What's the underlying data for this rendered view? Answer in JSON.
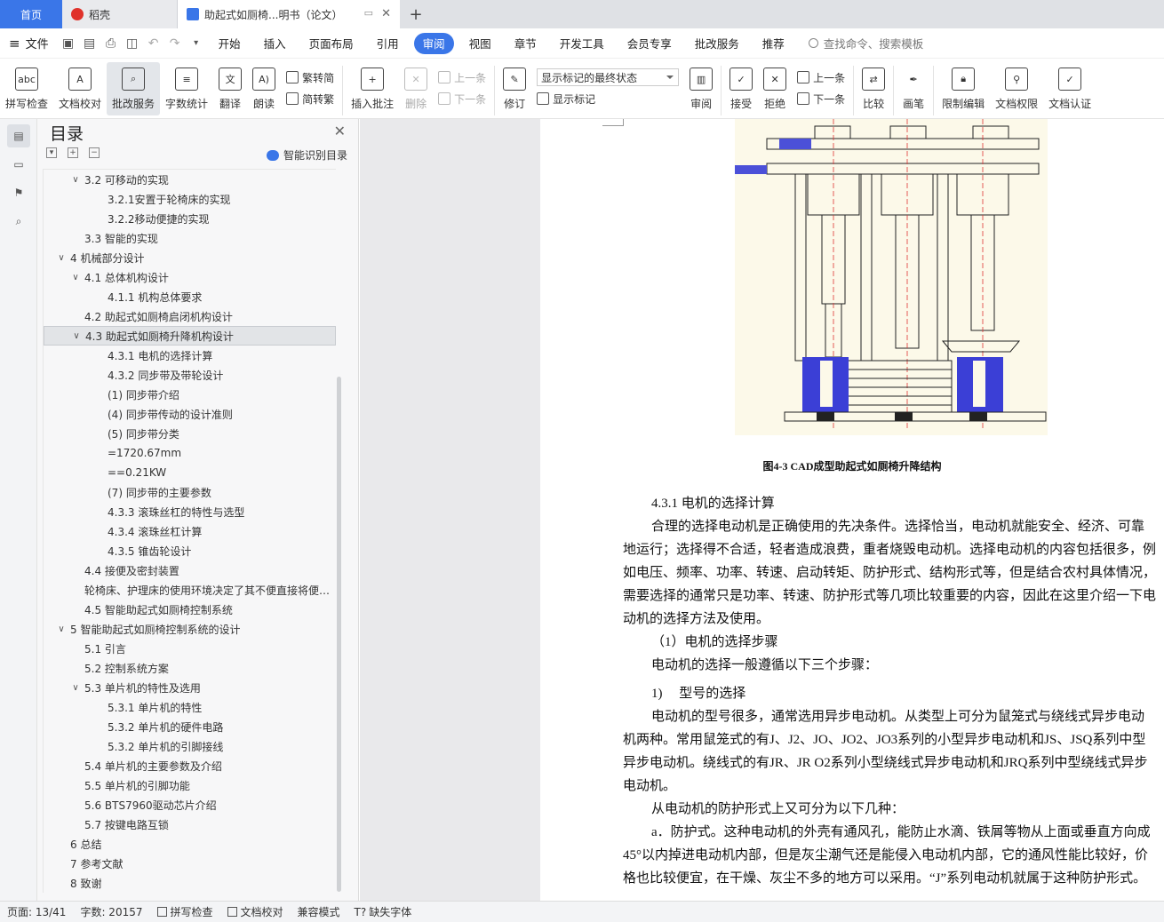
{
  "tabs": {
    "home": "首页",
    "docer": "稻壳",
    "doc": "助起式如厕椅...明书（论文）"
  },
  "menu": {
    "file": "文件",
    "items": [
      "开始",
      "插入",
      "页面布局",
      "引用",
      "审阅",
      "视图",
      "章节",
      "开发工具",
      "会员专享",
      "批改服务",
      "推荐"
    ],
    "active": "审阅",
    "search": "查找命令、搜索模板"
  },
  "ribbon": {
    "spell": "拼写检查",
    "proof": "文档校对",
    "review_service": "批改服务",
    "word_count": "字数统计",
    "translate": "翻译",
    "read": "朗读",
    "trad": "繁转简",
    "simp": "简转繁",
    "insert_comment": "插入批注",
    "delete": "删除",
    "prev": "上一条",
    "next": "下一条",
    "track": "修订",
    "markup_state": "显示标记的最终状态",
    "show_markup": "显示标记",
    "review": "审阅",
    "accept": "接受",
    "reject": "拒绝",
    "prev2": "上一条",
    "next2": "下一条",
    "compare": "比较",
    "pen": "画笔",
    "restrict": "限制编辑",
    "rights": "文档权限",
    "auth": "文档认证"
  },
  "toc": {
    "title": "目录",
    "smart": "智能识别目录",
    "items": [
      {
        "level": 2,
        "text": "3.2 可移动的实现",
        "chev": "∨"
      },
      {
        "level": 3,
        "text": "3.2.1安置于轮椅床的实现",
        "chev": ""
      },
      {
        "level": 3,
        "text": "3.2.2移动便捷的实现",
        "chev": ""
      },
      {
        "level": 2,
        "text": "3.3 智能的实现",
        "chev": ""
      },
      {
        "level": 1,
        "text": "4 机械部分设计",
        "chev": "∨"
      },
      {
        "level": 2,
        "text": "4.1 总体机构设计",
        "chev": "∨"
      },
      {
        "level": 3,
        "text": "4.1.1 机构总体要求",
        "chev": ""
      },
      {
        "level": 2,
        "text": "4.2 助起式如厕椅启闭机构设计",
        "chev": ""
      },
      {
        "level": 2,
        "text": "4.3 助起式如厕椅升降机构设计",
        "chev": "∨",
        "selected": true
      },
      {
        "level": 3,
        "text": "4.3.1 电机的选择计算",
        "chev": ""
      },
      {
        "level": 3,
        "text": "4.3.2 同步带及带轮设计",
        "chev": ""
      },
      {
        "level": 3,
        "text": "(1) 同步带介绍",
        "chev": ""
      },
      {
        "level": 3,
        "text": "(4) 同步带传动的设计准则",
        "chev": ""
      },
      {
        "level": 3,
        "text": "(5) 同步带分类",
        "chev": ""
      },
      {
        "level": 3,
        "text": "=1720.67mm",
        "chev": ""
      },
      {
        "level": 3,
        "text": "==0.21KW",
        "chev": ""
      },
      {
        "level": 3,
        "text": "(7) 同步带的主要参数",
        "chev": ""
      },
      {
        "level": 3,
        "text": "4.3.3 滚珠丝杠的特性与选型",
        "chev": ""
      },
      {
        "level": 3,
        "text": "4.3.4 滚珠丝杠计算",
        "chev": ""
      },
      {
        "level": 3,
        "text": "4.3.5 锥齿轮设计",
        "chev": ""
      },
      {
        "level": 2,
        "text": "4.4 接便及密封装置",
        "chev": ""
      },
      {
        "level": 2,
        "text": "轮椅床、护理床的使用环境决定了其不便直接将便…",
        "chev": ""
      },
      {
        "level": 2,
        "text": "4.5 智能助起式如厕椅控制系统",
        "chev": ""
      },
      {
        "level": 1,
        "text": "5 智能助起式如厕椅控制系统的设计",
        "chev": "∨"
      },
      {
        "level": 2,
        "text": "5.1 引言",
        "chev": ""
      },
      {
        "level": 2,
        "text": "5.2 控制系统方案",
        "chev": ""
      },
      {
        "level": 2,
        "text": "5.3 单片机的特性及选用",
        "chev": "∨"
      },
      {
        "level": 3,
        "text": "5.3.1 单片机的特性",
        "chev": ""
      },
      {
        "level": 3,
        "text": "5.3.2 单片机的硬件电路",
        "chev": ""
      },
      {
        "level": 3,
        "text": "5.3.2 单片机的引脚接线",
        "chev": ""
      },
      {
        "level": 2,
        "text": "5.4 单片机的主要参数及介绍",
        "chev": ""
      },
      {
        "level": 2,
        "text": "5.5 单片机的引脚功能",
        "chev": ""
      },
      {
        "level": 2,
        "text": "5.6 BTS7960驱动芯片介绍",
        "chev": ""
      },
      {
        "level": 2,
        "text": "5.7 按键电路互锁",
        "chev": ""
      },
      {
        "level": 1,
        "text": "6 总结",
        "chev": ""
      },
      {
        "level": 1,
        "text": "7 参考文献",
        "chev": ""
      },
      {
        "level": 1,
        "text": "8 致谢",
        "chev": ""
      }
    ]
  },
  "doc": {
    "caption": "图4-3 CAD成型助起式如厕椅升降结构",
    "heading": "4.3.1 电机的选择计算",
    "p1": "合理的选择电动机是正确使用的先决条件。选择恰当，电动机就能安全、经济、可靠地运行；选择得不合适，轻者造成浪费，重者烧毁电动机。选择电动机的内容包括很多，例如电压、频率、功率、转速、启动转矩、防护形式、结构形式等，但是结合农村具体情况，需要选择的通常只是功率、转速、防护形式等几项比较重要的内容，因此在这里介绍一下电动机的选择方法及使用。",
    "p2": "（1）电机的选择步骤",
    "p3": "电动机的选择一般遵循以下三个步骤：",
    "p4": "1)　 型号的选择",
    "p5": "电动机的型号很多，通常选用异步电动机。从类型上可分为鼠笼式与绕线式异步电动机两种。常用鼠笼式的有J、J2、JO、JO2、JO3系列的小型异步电动机和JS、JSQ系列中型异步电动机。绕线式的有JR、JR O2系列小型绕线式异步电动机和JRQ系列中型绕线式异步电动机。",
    "p6": "从电动机的防护形式上又可分为以下几种：",
    "p7": "a．防护式。这种电动机的外壳有通风孔，能防止水滴、铁屑等物从上面或垂直方向成45°以内掉进电动机内部，但是灰尘潮气还是能侵入电动机内部，它的通风性能比较好，价格也比较便宜，在干燥、灰尘不多的地方可以采用。“J”系列电动机就属于这种防护形式。"
  },
  "status": {
    "page": "页面: 13/41",
    "words": "字数: 20157",
    "spell": "拼写检查",
    "proof": "文档校对",
    "compat": "兼容模式",
    "font": "缺失字体"
  },
  "colors": {
    "accent": "#3a76e8",
    "cad_red": "#d33",
    "cad_blue": "#3b3fd6"
  }
}
